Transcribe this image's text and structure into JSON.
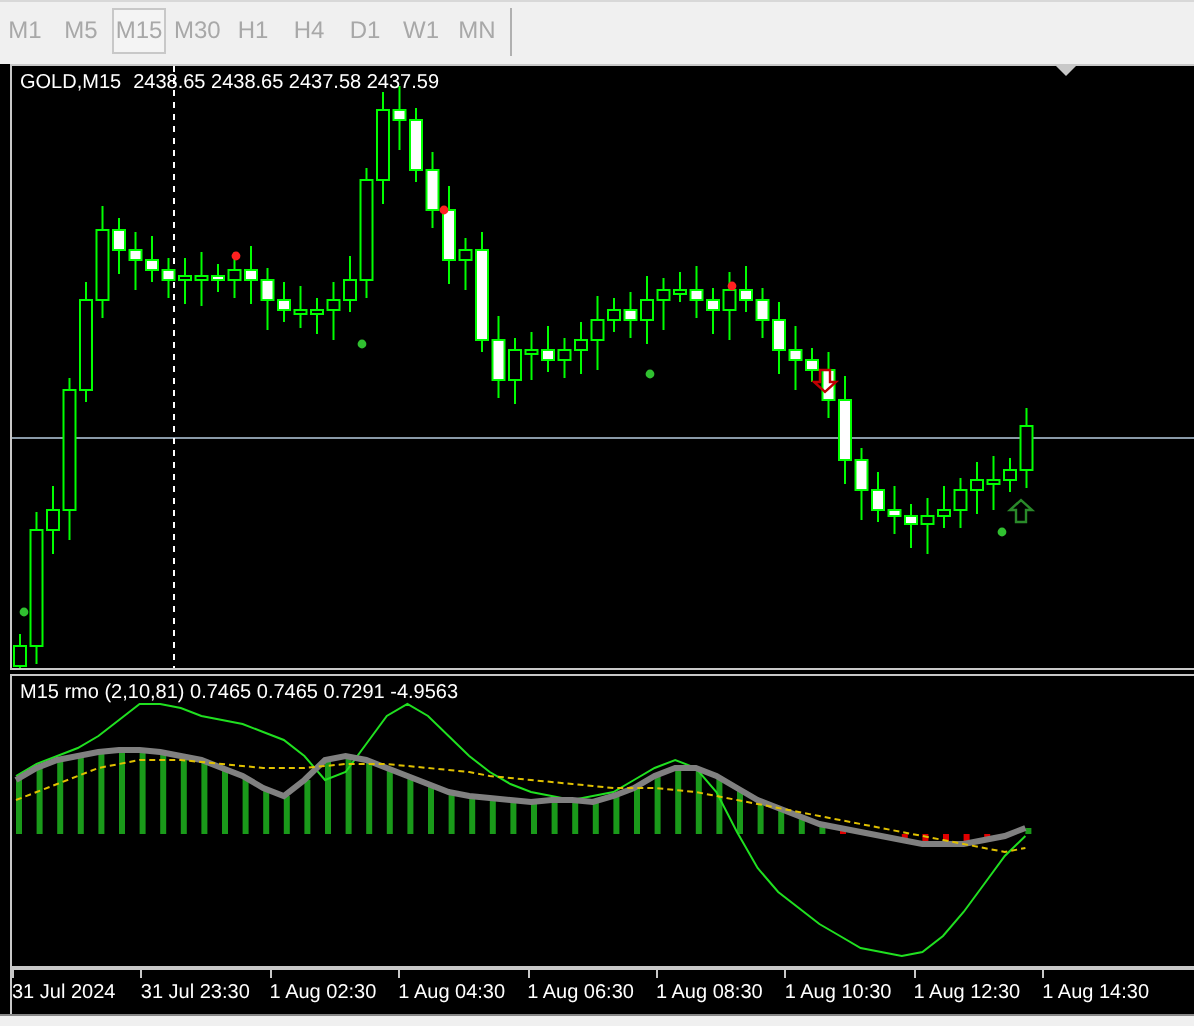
{
  "timeframes": [
    {
      "label": "M1",
      "selected": false
    },
    {
      "label": "M5",
      "selected": false
    },
    {
      "label": "M15",
      "selected": true
    },
    {
      "label": "M30",
      "selected": false
    },
    {
      "label": "H1",
      "selected": false
    },
    {
      "label": "H4",
      "selected": false
    },
    {
      "label": "D1",
      "selected": false
    },
    {
      "label": "W1",
      "selected": false
    },
    {
      "label": "MN",
      "selected": false
    }
  ],
  "chart": {
    "symbol": "GOLD,M15",
    "prices": "2438.65 2438.65 2437.58 2437.59"
  },
  "indicator": {
    "label": "M15 rmo (2,10,81) 0.7465 0.7465 0.7291 -4.9563"
  },
  "time_axis": [
    "31 Jul 2024",
    "31 Jul 23:30",
    "1 Aug 02:30",
    "1 Aug 04:30",
    "1 Aug 06:30",
    "1 Aug 08:30",
    "1 Aug 10:30",
    "1 Aug 12:30",
    "1 Aug 14:30"
  ]
}
